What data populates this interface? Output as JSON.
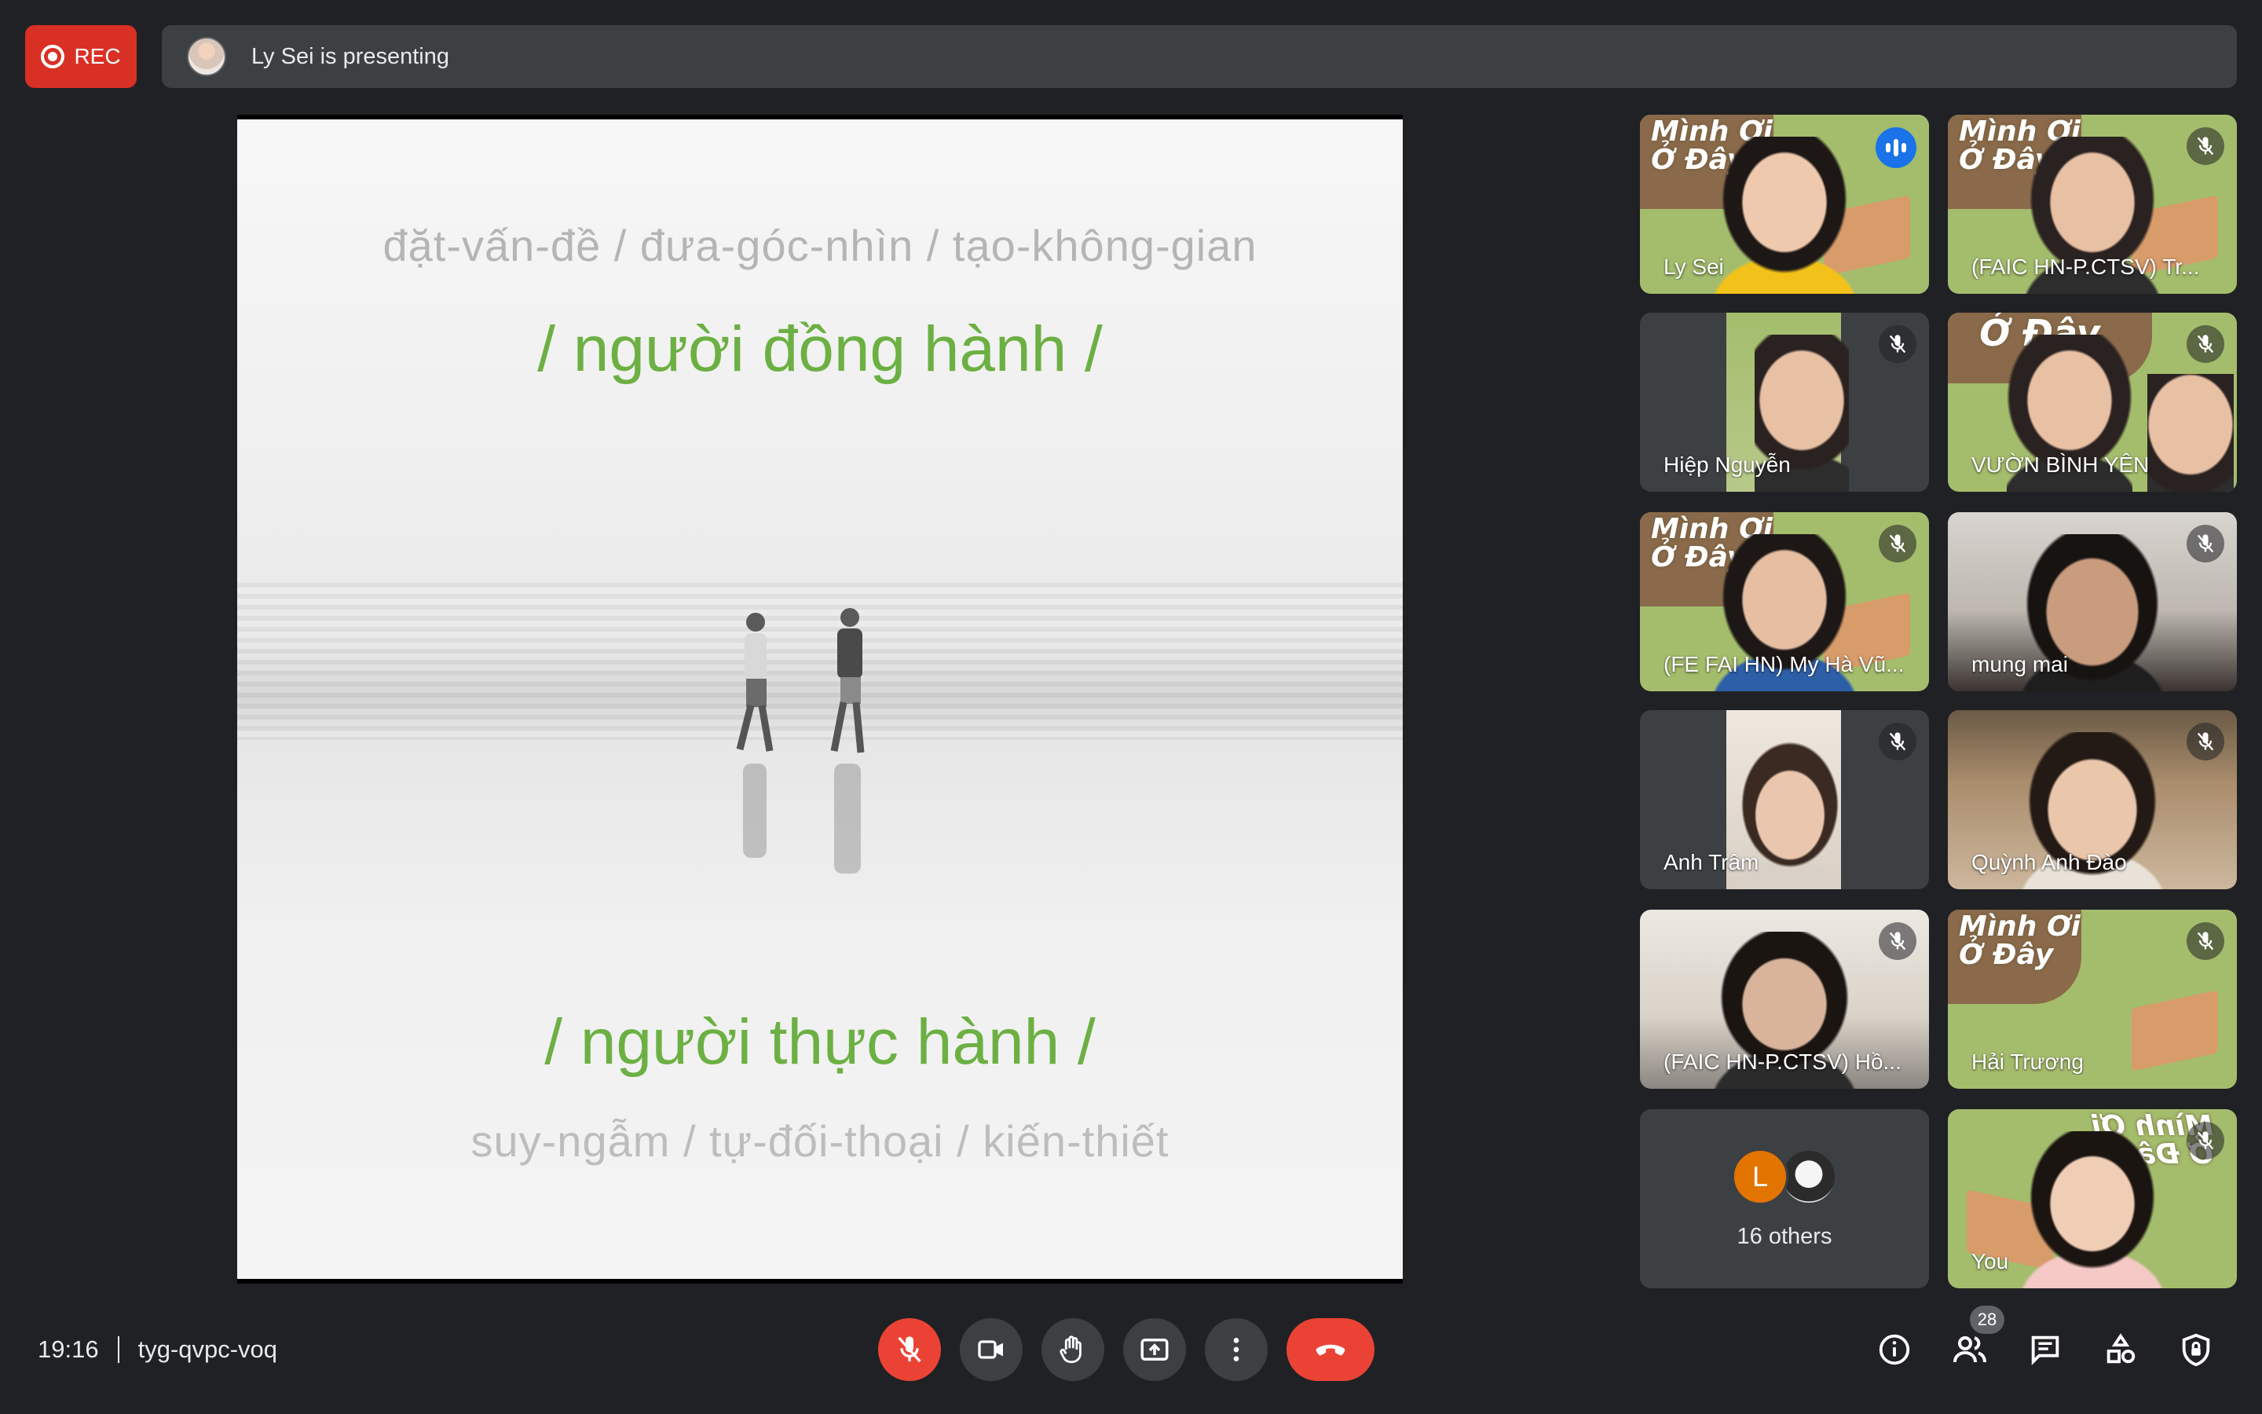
{
  "recording": {
    "label": "REC"
  },
  "presenting": {
    "text": "Ly Sei is presenting"
  },
  "slide": {
    "top_subtitle": "đặt-vấn-đề / đưa-góc-nhìn / tạo-không-gian",
    "heading_1": "/ người đồng hành /",
    "heading_2": "/ người thực hành /",
    "bottom_subtitle": "suy-ngẫm /  tự-đối-thoại  /  kiến-thiết",
    "accent_color": "#6cb043"
  },
  "brand_text": {
    "line1": "Mình Ơi",
    "line2": "Ở Đây"
  },
  "participants": [
    {
      "name": "Ly Sei",
      "state": "speaking"
    },
    {
      "name": "(FAIC HN-P.CTSV) Tr...",
      "state": "muted"
    },
    {
      "name": "Hiệp Nguyễn",
      "state": "muted"
    },
    {
      "name": "VƯỜN BÌNH YÊN",
      "state": "muted"
    },
    {
      "name": "(FE FAI HN) My Hà Vũ...",
      "state": "muted"
    },
    {
      "name": "mung mai",
      "state": "muted"
    },
    {
      "name": "Anh Trâm",
      "state": "muted"
    },
    {
      "name": "Quỳnh Anh Đào",
      "state": "muted"
    },
    {
      "name": "(FAIC HN-P.CTSV) Hồ...",
      "state": "muted"
    },
    {
      "name": "Hải Trương",
      "state": "muted"
    },
    {
      "name": "You",
      "state": "muted"
    }
  ],
  "others": {
    "avatar_letter": "L",
    "label": "16 others"
  },
  "meeting": {
    "time": "19:16",
    "code": "tyg-qvpc-voq"
  },
  "people_count": "28",
  "icons": {
    "controls": [
      "mic-off-icon",
      "camera-icon",
      "raise-hand-icon",
      "present-screen-icon",
      "more-options-icon",
      "end-call-icon"
    ],
    "right": [
      "info-icon",
      "people-icon",
      "chat-icon",
      "activities-icon",
      "host-controls-icon"
    ]
  },
  "colors": {
    "rec": "#d93025",
    "end_call": "#ea4335",
    "speaking": "#1a73e8",
    "active_outline": "#8ab4f8"
  }
}
